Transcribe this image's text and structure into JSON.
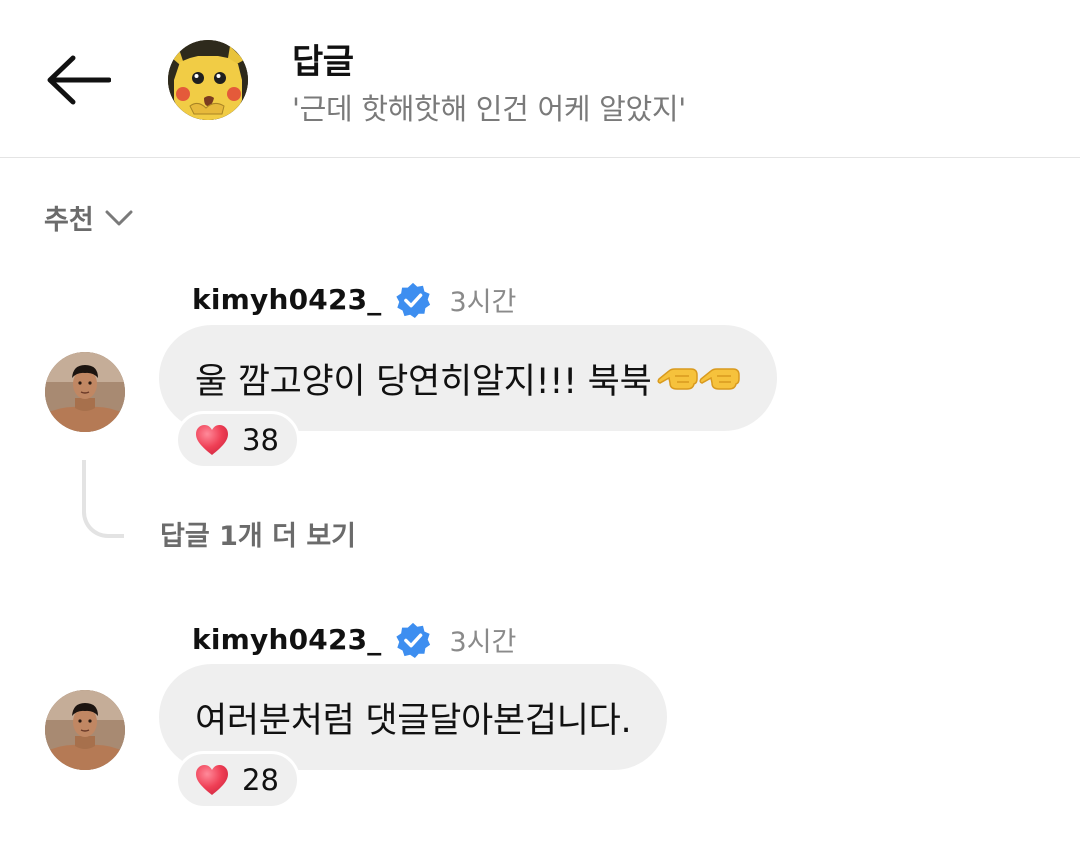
{
  "header": {
    "title": "답글",
    "subtitle": "'근데 핫해핫해 인건 어케 알았지'",
    "back_icon": "arrow-left-icon",
    "avatar": "pikachu-avatar"
  },
  "sort": {
    "label": "추천",
    "icon": "chevron-down-icon"
  },
  "comments": [
    {
      "username": "kimyh0423_",
      "verified": true,
      "time": "3시간",
      "text": "울 깜고양이 당연히알지!!! 북북",
      "emoji": "backhand-index-pointing-left x2",
      "likes": "38"
    },
    {
      "username": "kimyh0423_",
      "verified": true,
      "time": "3시간",
      "text": "여러분처럼 댓글달아본겁니다.",
      "likes": "28"
    }
  ],
  "thread": {
    "more_replies": "답글 1개 더 보기"
  },
  "colors": {
    "verified_blue": "#3d8ef0",
    "heart_red": "#ef3f55",
    "bubble_bg": "#efefef",
    "muted_text": "#7a7a7a"
  }
}
